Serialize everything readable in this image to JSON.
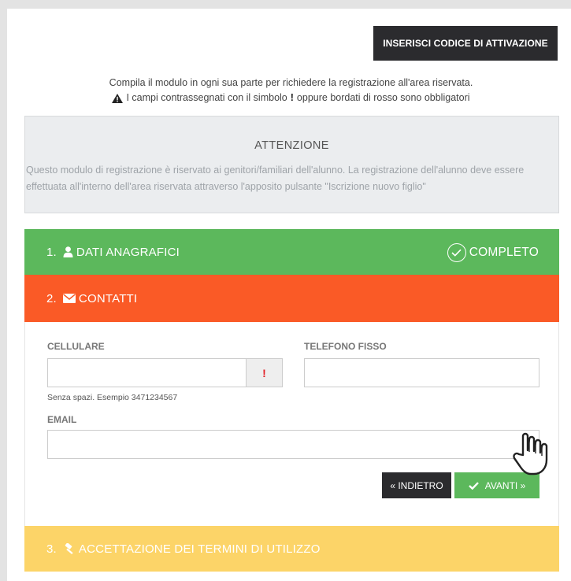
{
  "header": {
    "activation_button": "INSERISCI CODICE DI ATTIVAZIONE"
  },
  "intro": {
    "line1": "Compila il modulo in ogni sua parte per richiedere la registrazione all'area riservata.",
    "line2_before": "I campi contrassegnati con il simbolo",
    "line2_symbol": "!",
    "line2_after": "oppure bordati di rosso sono obbligatori"
  },
  "notice": {
    "title": "ATTENZIONE",
    "body": "Questo modulo di registrazione è riservato ai genitori/familiari dell'alunno. La registrazione dell'alunno deve essere effettuata all'interno dell'area riservata attraverso l'apposito pulsante \"Iscrizione nuovo figlio\""
  },
  "steps": [
    {
      "number": "1.",
      "label": "DATI ANAGRAFICI",
      "icon": "user-icon",
      "status": "COMPLETO"
    },
    {
      "number": "2.",
      "label": "CONTATTI",
      "icon": "envelope-icon"
    },
    {
      "number": "3.",
      "label": "ACCETTAZIONE DEI TERMINI DI UTILIZZO",
      "icon": "gavel-icon"
    }
  ],
  "form": {
    "mobile_label": "CELLULARE",
    "mobile_value": "",
    "mobile_required_symbol": "!",
    "mobile_help": "Senza spazi. Esempio 3471234567",
    "phone_label": "TELEFONO FISSO",
    "phone_value": "",
    "email_label": "EMAIL",
    "email_value": ""
  },
  "buttons": {
    "back": "« INDIETRO",
    "next": "AVANTI »"
  },
  "colors": {
    "step_complete": "#5cb85c",
    "step_active": "#fa5a26",
    "step_pending": "#fcd468",
    "dark_button": "#2b2b2e",
    "required": "#e21f26"
  }
}
